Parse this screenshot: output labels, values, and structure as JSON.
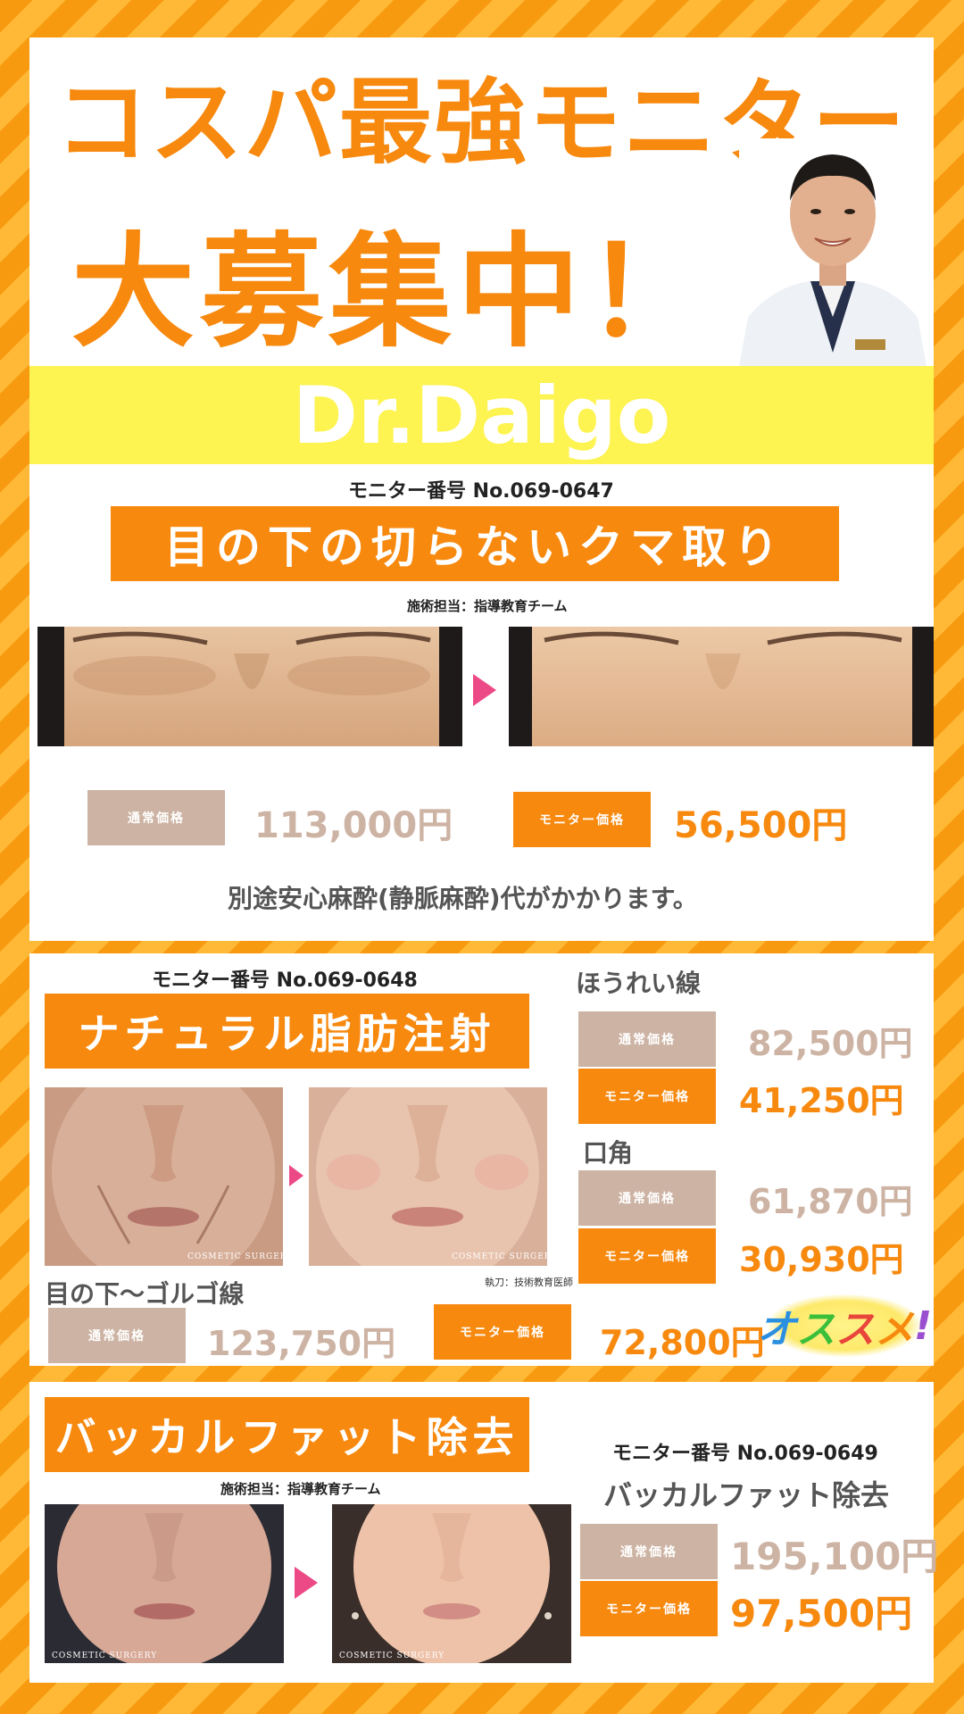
{
  "header": {
    "headline_line1": "コスパ最強モニター",
    "headline_line2": "大募集中！",
    "doctor_name": "Dr.Daigo"
  },
  "section1": {
    "monitor_no": "モニター番号 No.069-0647",
    "title": "目の下の切らないクマ取り",
    "staff": "施術担当：指導教育チーム",
    "regular_label": "通常価格",
    "regular_price": "113,000円",
    "monitor_label": "モニター価格",
    "monitor_price": "56,500円",
    "note": "別途安心麻酔(静脈麻酔)代がかかります。"
  },
  "section2": {
    "monitor_no": "モニター番号 No.069-0648",
    "title": "ナチュラル脂肪注射",
    "surgeon": "執刀：技術教育医師",
    "logo_text": "COSMETIC SURGERY",
    "areas": [
      {
        "name": "ほうれい線",
        "regular_label": "通常価格",
        "regular_price": "82,500円",
        "monitor_label": "モニター価格",
        "monitor_price": "41,250円"
      },
      {
        "name": "口角",
        "regular_label": "通常価格",
        "regular_price": "61,870円",
        "monitor_label": "モニター価格",
        "monitor_price": "30,930円"
      },
      {
        "name": "目の下〜ゴルゴ線",
        "regular_label": "通常価格",
        "regular_price": "123,750円",
        "monitor_label": "モニター価格",
        "monitor_price": "72,800円"
      }
    ],
    "recommend": "オススメ!"
  },
  "section3": {
    "title": "バッカルファット除去",
    "staff": "施術担当：指導教育チーム",
    "monitor_no": "モニター番号 No.069-0649",
    "subtitle": "バッカルファット除去",
    "regular_label": "通常価格",
    "regular_price": "195,100円",
    "monitor_label": "モニター価格",
    "monitor_price": "97,500円",
    "logo_text": "COSMETIC SURGERY"
  },
  "colors": {
    "accent_orange": "#f7890f",
    "stripe_light": "#ffb936",
    "banner_yellow": "#fdf351",
    "regular_beige": "#cdb3a3",
    "arrow_pink": "#ec4a86"
  }
}
